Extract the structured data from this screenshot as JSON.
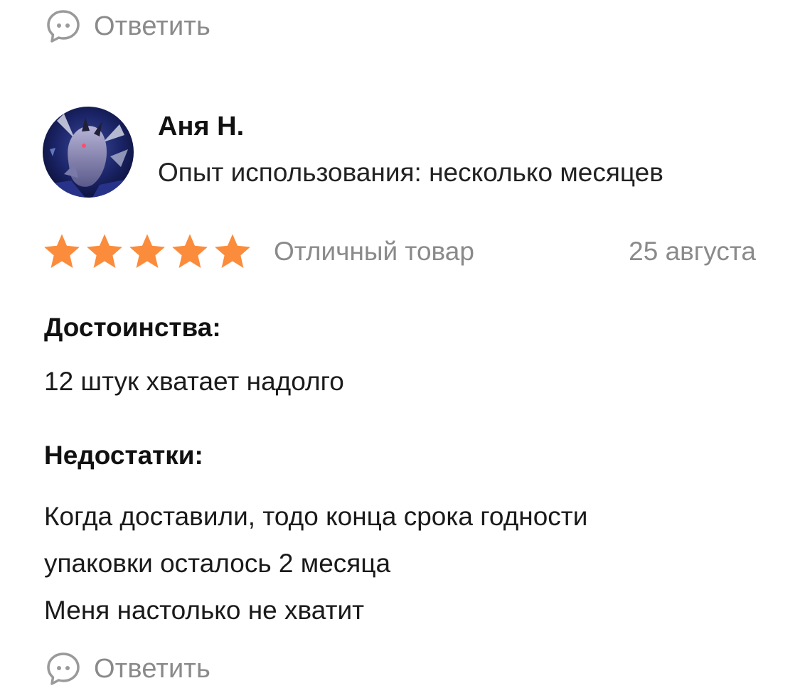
{
  "reply_top": {
    "label": "Ответить",
    "icon": "chat-bubble-icon"
  },
  "review": {
    "author": "Аня Н.",
    "experience": "Опыт использования: несколько месяцев",
    "rating": {
      "value": 5,
      "max": 5
    },
    "verdict": "Отличный товар",
    "date": "25 августа",
    "pros_title": "Достоинства:",
    "pros_text": "12 штук хватает надолго",
    "cons_title": "Недостатки:",
    "cons_lines": [
      "Когда доставили, тодо конца срока годности",
      "упаковки осталось 2 месяца",
      "Меня настолько не хватит"
    ]
  },
  "reply_bottom": {
    "label": "Ответить",
    "icon": "chat-bubble-icon"
  },
  "colors": {
    "star": "#fb8c3c",
    "muted_text": "#8a8a8a",
    "icon": "#9a9a9a"
  }
}
